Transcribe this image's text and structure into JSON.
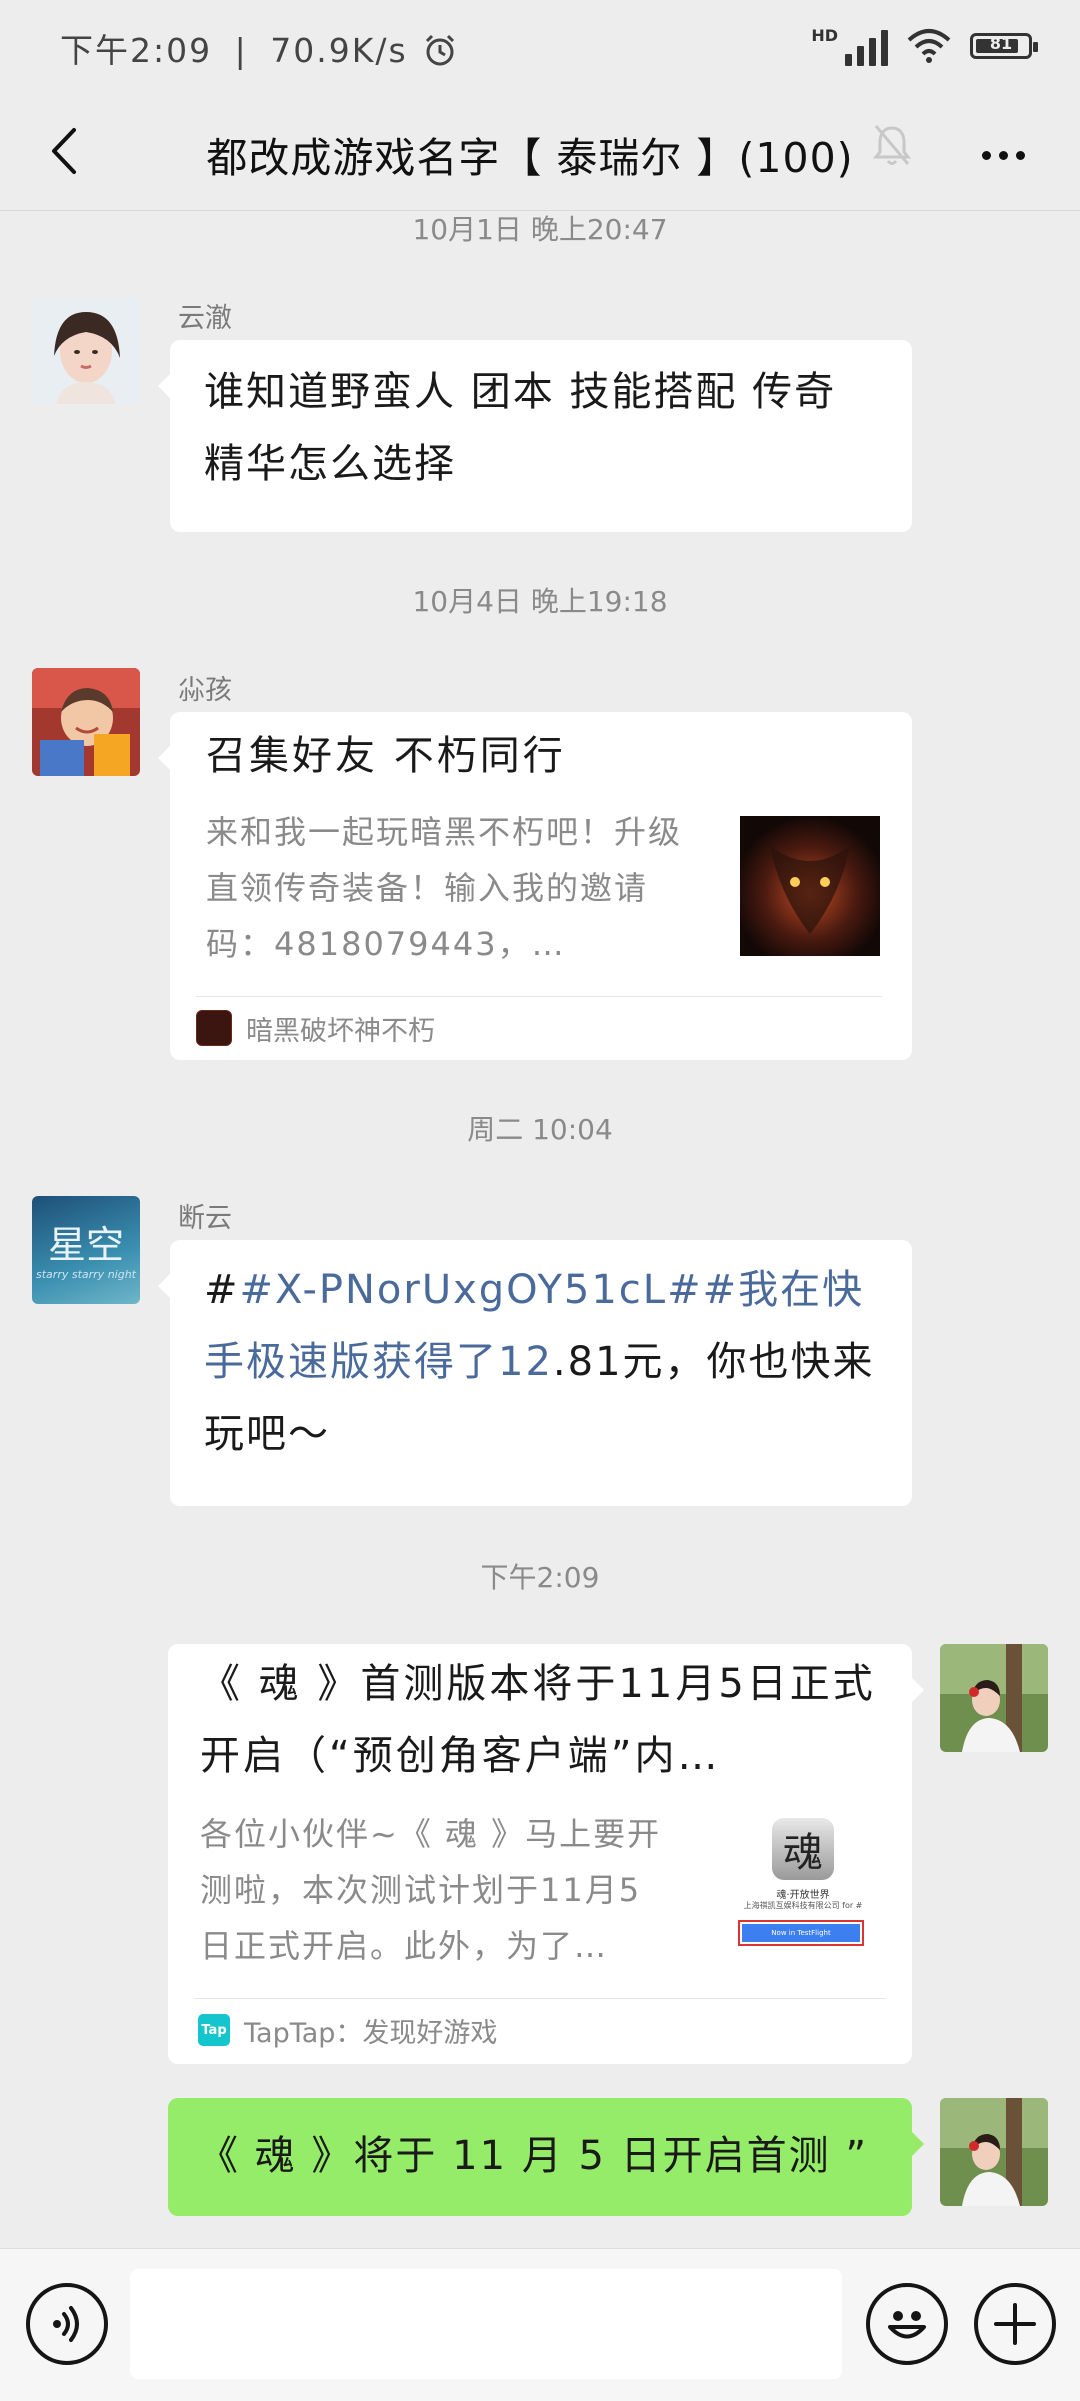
{
  "status_bar": {
    "time": "下午2:09",
    "speed": "70.9K/s",
    "network": "HD",
    "battery_level": "81"
  },
  "header": {
    "back_icon": "chevron-left-icon",
    "title": "都改成游戏名字【 泰瑞尔 】(100)",
    "mute_icon": "bell-off-icon",
    "more_icon": "more-dots-icon"
  },
  "messages": [
    {
      "timestamp": "10月1日 晚上20:47",
      "sender": "云澈",
      "text": "谁知道野蛮人 团本 技能搭配 传奇精华怎么选择"
    },
    {
      "timestamp": "10月4日 晚上19:18",
      "sender": "尛孩",
      "card_title": "召集好友 不朽同行",
      "card_desc": "来和我一起玩暗黑不朽吧！升级直领传奇装备！输入我的邀请码：4818079443，…",
      "card_source": "暗黑破坏神不朽"
    },
    {
      "timestamp": "周二 10:04",
      "sender": "断云",
      "avatar_text": "星空",
      "avatar_subtext": "starry starry night",
      "text_prefix": "#",
      "text_link": "#X-PNorUxgOY51cL#",
      "text_link2": "#我在快手极速版获得了12",
      "text_rest": ".81元，你也快来玩吧～"
    },
    {
      "timestamp": "下午2:09",
      "card_title": "《 魂 》首测版本将于11月5日正式开启（“预创角客户端”内…",
      "card_desc": "各位小伙伴~《 魂 》马上要开测啦，本次测试计划于11月5日正式开启。此外，为了…",
      "card_thumb_title": "魂",
      "card_thumb_sub": "魂·开放世界",
      "card_thumb_company": "上海祺凯互娱科技有限公司 for #",
      "card_thumb_button": "Now in TestFlight",
      "card_source_icon": "Tap",
      "card_source": "TapTap：发现好游戏"
    },
    {
      "text": "《 魂 》将于 11 月 5 日开启首测 ”"
    }
  ],
  "input_bar": {
    "voice_icon": "voice-icon",
    "emoji_icon": "emoji-icon",
    "plus_icon": "plus-icon"
  }
}
